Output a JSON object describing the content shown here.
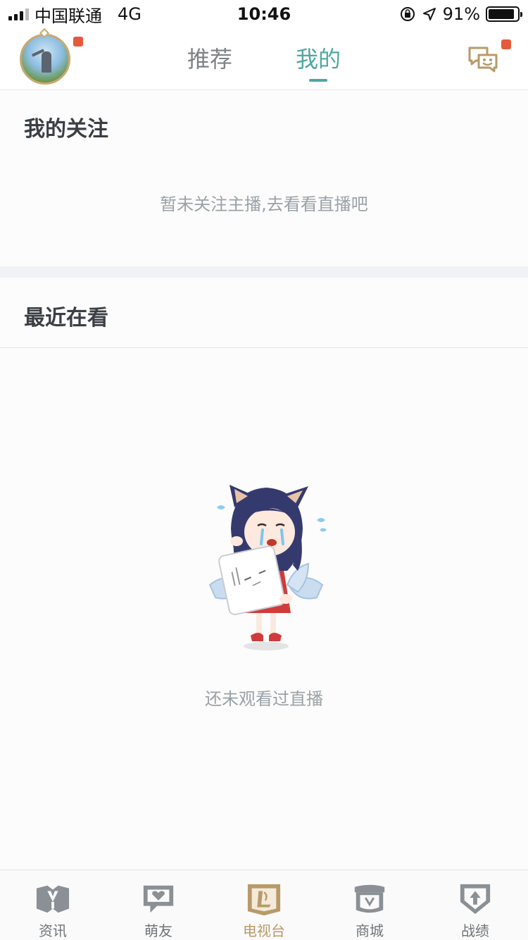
{
  "status_bar": {
    "carrier": "中国联通",
    "network": "4G",
    "time": "10:46",
    "battery": "91%",
    "battery_level": 0.91
  },
  "header": {
    "tabs": [
      {
        "label": "推荐",
        "active": false
      },
      {
        "label": "我的",
        "active": true
      }
    ],
    "accent_color": "#4fa7a0",
    "badge_color": "#e55a3c"
  },
  "follow": {
    "title": "我的关注",
    "empty_text": "暂未关注主播,去看看直播吧"
  },
  "recent": {
    "title": "最近在看",
    "empty_text": "还未观看过直播"
  },
  "bottom_nav": {
    "items": [
      {
        "label": "资讯",
        "icon": "news-icon",
        "active": false
      },
      {
        "label": "萌友",
        "icon": "friends-icon",
        "active": false
      },
      {
        "label": "电视台",
        "icon": "tv-icon",
        "active": true
      },
      {
        "label": "商城",
        "icon": "shop-icon",
        "active": false
      },
      {
        "label": "战绩",
        "icon": "record-icon",
        "active": false
      }
    ],
    "active_color": "#b89a6a",
    "inactive_color": "#6f7478"
  }
}
